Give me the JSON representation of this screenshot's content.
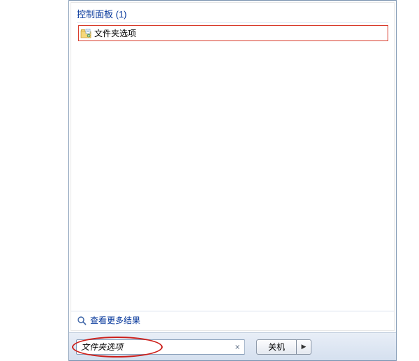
{
  "group": {
    "header": "控制面板 (1)"
  },
  "results": {
    "folder_options": "文件夹选项"
  },
  "see_more": "查看更多结果",
  "search": {
    "value": "文件夹选项"
  },
  "shutdown": {
    "label": "关机"
  }
}
